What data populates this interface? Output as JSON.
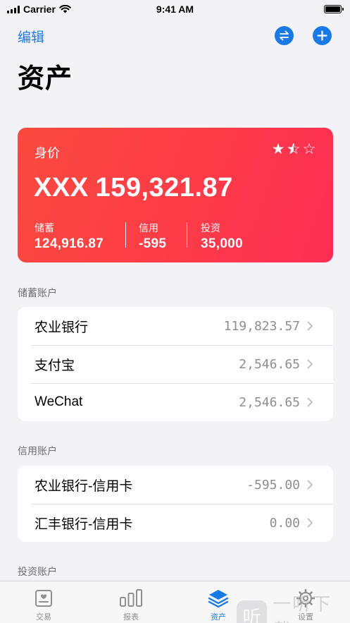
{
  "status_bar": {
    "carrier": "Carrier",
    "time": "9:41 AM"
  },
  "nav": {
    "edit_label": "编辑",
    "title": "资产"
  },
  "net_worth": {
    "label": "身价",
    "currency": "XXX",
    "amount": "159,321.87",
    "rating": 1.5,
    "rating_max": 3,
    "metrics": [
      {
        "label": "储蓄",
        "value": "124,916.87"
      },
      {
        "label": "信用",
        "value": "-595"
      },
      {
        "label": "投资",
        "value": "35,000"
      }
    ]
  },
  "savings": {
    "header": "储蓄账户",
    "accounts": [
      {
        "name": "农业银行",
        "value": "119,823.57"
      },
      {
        "name": "支付宝",
        "value": "2,546.65"
      },
      {
        "name": "WeChat",
        "value": "2,546.65"
      }
    ]
  },
  "credit": {
    "header": "信用账户",
    "accounts": [
      {
        "name": "农业银行-信用卡",
        "value": "-595.00"
      },
      {
        "name": "汇丰银行-信用卡",
        "value": "0.00"
      }
    ]
  },
  "investment": {
    "header": "投资账户"
  },
  "tabs": [
    {
      "label": "交易",
      "icon": "transactions-icon",
      "active": false
    },
    {
      "label": "报表",
      "icon": "chart-bars-icon",
      "active": false
    },
    {
      "label": "资产",
      "icon": "layers-icon",
      "active": true
    },
    {
      "label": "设置",
      "icon": "gear-icon",
      "active": false
    }
  ],
  "watermark": {
    "badge": "听",
    "text": "一听下载"
  },
  "colors": {
    "accent": "#1a7ae5",
    "card_start": "#fb4a3f",
    "card_end": "#fd2e55",
    "background": "#f2f2f7"
  }
}
